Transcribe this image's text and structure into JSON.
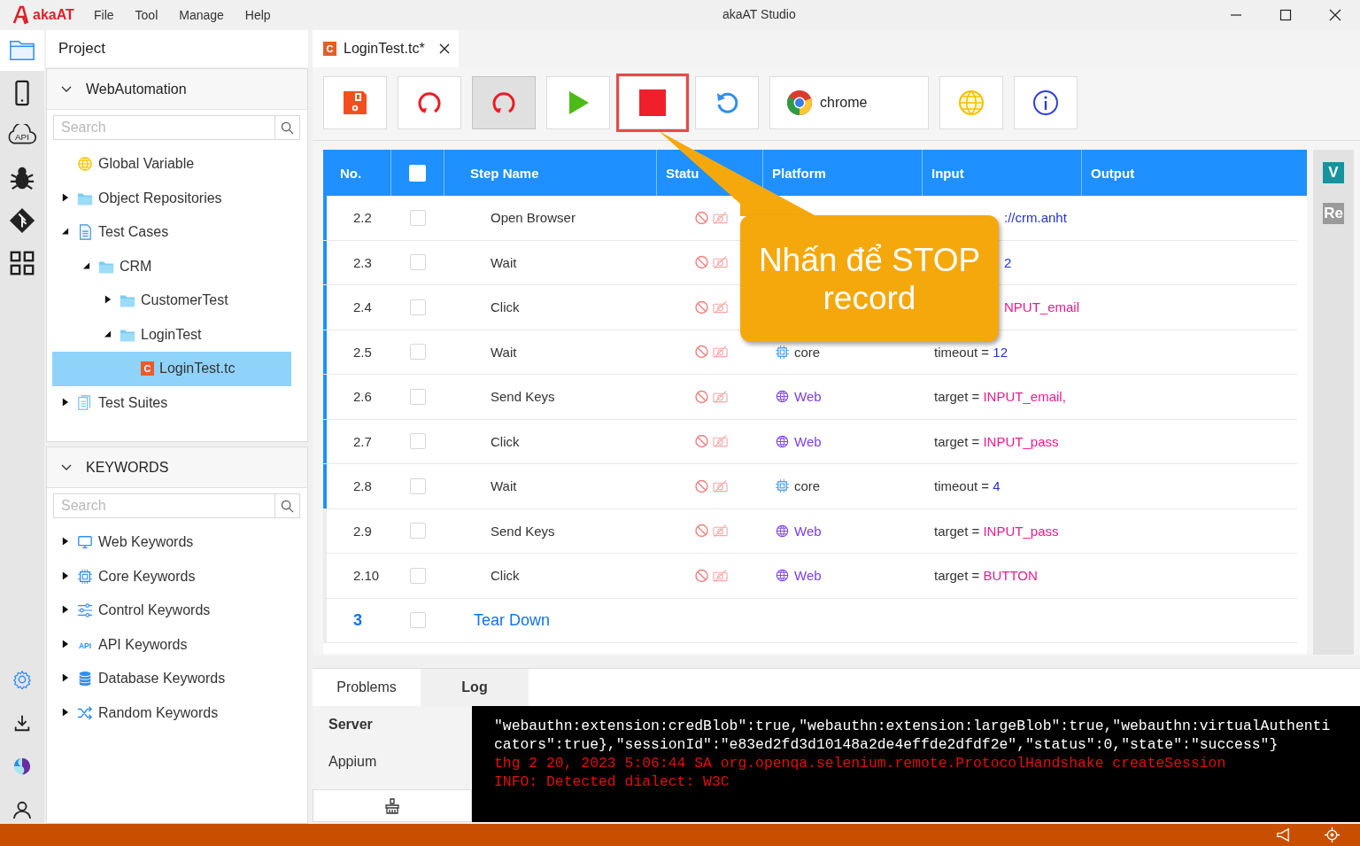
{
  "window": {
    "app_name": "akaAT",
    "title": "akaAT Studio"
  },
  "menu": [
    "File",
    "Tool",
    "Manage",
    "Help"
  ],
  "activity_bar": {
    "top": [
      {
        "kind": "folder",
        "selected": true
      },
      {
        "kind": "mobile",
        "selected": false
      },
      {
        "kind": "api",
        "label": "API",
        "selected": false
      },
      {
        "kind": "bug",
        "selected": false
      },
      {
        "kind": "git",
        "selected": false
      },
      {
        "kind": "grid",
        "selected": false
      }
    ],
    "bottom": [
      {
        "kind": "settings"
      },
      {
        "kind": "download"
      },
      {
        "kind": "logo"
      },
      {
        "kind": "user"
      }
    ]
  },
  "project": {
    "title": "Project",
    "section": {
      "title": "WebAutomation",
      "expanded": true
    },
    "search": {
      "placeholder": "Search"
    },
    "tree": [
      {
        "label": "Global Variable",
        "kind": "globe",
        "selected": false
      },
      {
        "label": "Object Repositories",
        "kind": "folder",
        "expanded": false,
        "selected": false
      },
      {
        "label": "Test Cases",
        "kind": "doc",
        "expanded": true,
        "selected": false,
        "children": [
          {
            "label": "CRM",
            "kind": "folder",
            "expanded": true,
            "selected": false,
            "children": [
              {
                "label": "CustomerTest",
                "kind": "folder",
                "expanded": false,
                "selected": false
              },
              {
                "label": "LoginTest",
                "kind": "folder",
                "expanded": true,
                "selected": false,
                "children": [
                  {
                    "label": "LoginTest.tc",
                    "kind": "tc",
                    "icon_text": "C",
                    "selected": true
                  }
                ]
              }
            ]
          }
        ]
      },
      {
        "label": "Test Suites",
        "kind": "suite",
        "expanded": false,
        "selected": false
      }
    ]
  },
  "keywords": {
    "title": "KEYWORDS",
    "expanded": true,
    "search": {
      "placeholder": "Search"
    },
    "items": [
      {
        "label": "Web Keywords",
        "kind": "monitor",
        "expanded": false
      },
      {
        "label": "Core Keywords",
        "kind": "chip",
        "expanded": false
      },
      {
        "label": "Control Keywords",
        "kind": "sliders",
        "expanded": false
      },
      {
        "label": "API Keywords",
        "kind": "api",
        "icon_text": "API",
        "expanded": false
      },
      {
        "label": "Database Keywords",
        "kind": "database",
        "expanded": false
      },
      {
        "label": "Random Keywords",
        "kind": "shuffle",
        "expanded": false
      }
    ]
  },
  "editor_tab": {
    "icon_text": "C",
    "label": "LoginTest.tc*",
    "selected": true
  },
  "toolbar": [
    {
      "kind": "save",
      "pressed": false,
      "highlighted": false
    },
    {
      "kind": "record",
      "pressed": false,
      "highlighted": false
    },
    {
      "kind": "record",
      "pressed": true,
      "highlighted": false
    },
    {
      "kind": "run",
      "pressed": false,
      "highlighted": false
    },
    {
      "kind": "stop",
      "pressed": false,
      "highlighted": true
    },
    {
      "kind": "undo",
      "pressed": false,
      "highlighted": false
    },
    {
      "kind": "browser",
      "label": "chrome",
      "pressed": false,
      "highlighted": false
    },
    {
      "kind": "globe",
      "pressed": false,
      "highlighted": false
    },
    {
      "kind": "info",
      "pressed": false,
      "highlighted": false
    }
  ],
  "table": {
    "columns": [
      "No.",
      "Step Name",
      "Statu",
      "Platform",
      "Input",
      "Output"
    ],
    "header_checked": false,
    "rows": [
      {
        "kind": "step",
        "no": "2.2",
        "checked": false,
        "step": "Open Browser",
        "selected": true,
        "input": {
          "value": "://crm.anht",
          "kind": "text"
        }
      },
      {
        "kind": "step",
        "no": "2.3",
        "checked": false,
        "step": "Wait",
        "selected": true,
        "input": {
          "value": "2",
          "kind": "text"
        }
      },
      {
        "kind": "step",
        "no": "2.4",
        "checked": false,
        "step": "Click",
        "selected": true,
        "input": {
          "value": "NPUT_email",
          "kind": "object"
        }
      },
      {
        "kind": "step",
        "no": "2.5",
        "checked": false,
        "step": "Wait",
        "selected": true,
        "platform": {
          "kind": "core",
          "label": "core"
        },
        "input": {
          "key": "timeout",
          "operator": "=",
          "value": "12",
          "kind": "text"
        }
      },
      {
        "kind": "step",
        "no": "2.6",
        "checked": false,
        "step": "Send Keys",
        "selected": true,
        "platform": {
          "kind": "web",
          "label": "Web"
        },
        "input": {
          "key": "target",
          "operator": "=",
          "value": "INPUT_email,",
          "kind": "object"
        }
      },
      {
        "kind": "step",
        "no": "2.7",
        "checked": false,
        "step": "Click",
        "selected": true,
        "platform": {
          "kind": "web",
          "label": "Web"
        },
        "input": {
          "key": "target",
          "operator": "=",
          "value": "INPUT_pass",
          "kind": "object"
        }
      },
      {
        "kind": "step",
        "no": "2.8",
        "checked": false,
        "step": "Wait",
        "selected": true,
        "platform": {
          "kind": "core",
          "label": "core"
        },
        "input": {
          "key": "timeout",
          "operator": "=",
          "value": "4",
          "kind": "text"
        }
      },
      {
        "kind": "step",
        "no": "2.9",
        "checked": false,
        "step": "Send Keys",
        "selected": false,
        "platform": {
          "kind": "web",
          "label": "Web"
        },
        "input": {
          "key": "target",
          "operator": "=",
          "value": "INPUT_pass",
          "kind": "object"
        }
      },
      {
        "kind": "step",
        "no": "2.10",
        "checked": false,
        "step": "Click",
        "selected": false,
        "platform": {
          "kind": "web",
          "label": "Web"
        },
        "input": {
          "key": "target",
          "operator": "=",
          "value": "BUTTON",
          "kind": "object"
        }
      },
      {
        "kind": "group",
        "no": "3",
        "checked": false,
        "step": "Tear Down",
        "selected": false
      }
    ]
  },
  "side_badges": [
    {
      "label": "V",
      "color": "#17939e"
    },
    {
      "label": "Re",
      "color": "#9a9a9a"
    }
  ],
  "callout": {
    "text": "Nhấn để STOP record"
  },
  "bottom_panel": {
    "tabs": [
      {
        "label": "Problems",
        "selected": false
      },
      {
        "label": "Log",
        "selected": true
      }
    ],
    "sources": [
      {
        "label": "Server",
        "selected": true
      },
      {
        "label": "Appium",
        "selected": false
      }
    ],
    "log": [
      {
        "kind": "out",
        "text": "\"webauthn:extension:credBlob\":true,\"webauthn:extension:largeBlob\":true,\"webauthn:virtualAuthenticators\":true},\"sessionId\":\"e83ed2fd3d10148a2de4effde2dfdf2e\",\"status\":0,\"state\":\"success\"}"
      },
      {
        "kind": "err",
        "text": "thg 2 20, 2023 5:06:44 SA org.openqa.selenium.remote.ProtocolHandshake createSession"
      },
      {
        "kind": "err",
        "text": "INFO: Detected dialect: W3C"
      }
    ]
  }
}
